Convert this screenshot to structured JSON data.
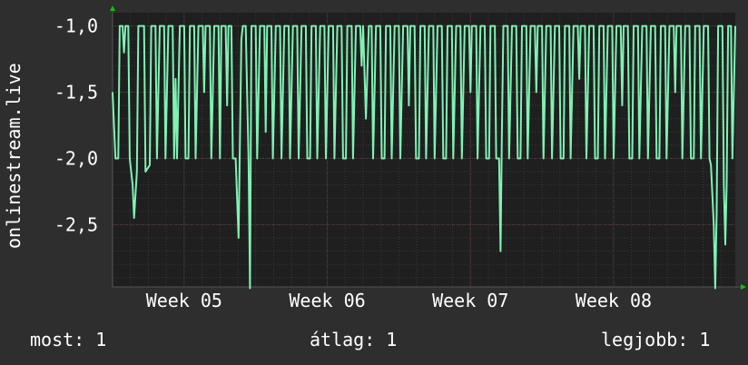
{
  "chart_data": {
    "type": "line",
    "ylabel": "onlinestream.live",
    "y_ticks": [
      "-1,0",
      "-1,5",
      "-2,0",
      "-2,5"
    ],
    "y_tick_values": [
      -1.0,
      -1.5,
      -2.0,
      -2.5
    ],
    "ylim": [
      -2.97,
      -0.9
    ],
    "x_ticks": [
      "Week 05",
      "Week 06",
      "Week 07",
      "Week 08"
    ],
    "xlim": [
      4.5,
      8.85
    ],
    "x_tick_values": [
      5,
      6,
      7,
      8
    ],
    "grid": true,
    "background": "#1f1f1f",
    "line_color": "#7ff2b4",
    "grid_color": "#3a3a3a",
    "axis_arrow_color": "#00cc00",
    "series": [
      {
        "name": "",
        "points": [
          [
            4.5,
            -1.5
          ],
          [
            4.52,
            -2.0
          ],
          [
            4.54,
            -2.0
          ],
          [
            4.55,
            -1.0
          ],
          [
            4.57,
            -1.0
          ],
          [
            4.58,
            -1.2
          ],
          [
            4.59,
            -1.0
          ],
          [
            4.61,
            -1.0
          ],
          [
            4.62,
            -2.0
          ],
          [
            4.64,
            -2.2
          ],
          [
            4.65,
            -2.45
          ],
          [
            4.67,
            -2.1
          ],
          [
            4.68,
            -1.0
          ],
          [
            4.72,
            -1.0
          ],
          [
            4.73,
            -2.1
          ],
          [
            4.76,
            -2.05
          ],
          [
            4.77,
            -1.0
          ],
          [
            4.8,
            -1.0
          ],
          [
            4.81,
            -2.0
          ],
          [
            4.83,
            -1.0
          ],
          [
            4.86,
            -1.0
          ],
          [
            4.87,
            -2.0
          ],
          [
            4.89,
            -1.0
          ],
          [
            4.92,
            -1.0
          ],
          [
            4.93,
            -2.0
          ],
          [
            4.94,
            -1.4
          ],
          [
            4.95,
            -2.0
          ],
          [
            4.97,
            -1.0
          ],
          [
            5.0,
            -1.0
          ],
          [
            5.01,
            -2.0
          ],
          [
            5.03,
            -2.0
          ],
          [
            5.04,
            -1.0
          ],
          [
            5.07,
            -1.0
          ],
          [
            5.08,
            -2.0
          ],
          [
            5.1,
            -1.0
          ],
          [
            5.13,
            -1.0
          ],
          [
            5.14,
            -1.5
          ],
          [
            5.15,
            -1.0
          ],
          [
            5.18,
            -1.0
          ],
          [
            5.19,
            -2.0
          ],
          [
            5.21,
            -1.0
          ],
          [
            5.24,
            -1.0
          ],
          [
            5.25,
            -2.0
          ],
          [
            5.26,
            -1.0
          ],
          [
            5.29,
            -1.0
          ],
          [
            5.3,
            -1.6
          ],
          [
            5.31,
            -1.0
          ],
          [
            5.33,
            -1.0
          ],
          [
            5.34,
            -2.0
          ],
          [
            5.36,
            -2.0
          ],
          [
            5.37,
            -2.3
          ],
          [
            5.38,
            -2.6
          ],
          [
            5.4,
            -1.1
          ],
          [
            5.41,
            -1.0
          ],
          [
            5.43,
            -1.0
          ],
          [
            5.44,
            -1.5
          ],
          [
            5.45,
            -2.0
          ],
          [
            5.46,
            -2.98
          ],
          [
            5.47,
            -1.0
          ],
          [
            5.5,
            -1.0
          ],
          [
            5.51,
            -2.0
          ],
          [
            5.53,
            -1.0
          ],
          [
            5.56,
            -1.0
          ],
          [
            5.57,
            -1.8
          ],
          [
            5.58,
            -1.0
          ],
          [
            5.61,
            -1.0
          ],
          [
            5.62,
            -2.0
          ],
          [
            5.64,
            -1.0
          ],
          [
            5.67,
            -1.0
          ],
          [
            5.68,
            -2.0
          ],
          [
            5.7,
            -1.0
          ],
          [
            5.73,
            -1.0
          ],
          [
            5.74,
            -2.0
          ],
          [
            5.75,
            -1.5
          ],
          [
            5.76,
            -1.0
          ],
          [
            5.79,
            -1.0
          ],
          [
            5.8,
            -2.0
          ],
          [
            5.82,
            -1.0
          ],
          [
            5.85,
            -1.0
          ],
          [
            5.86,
            -2.0
          ],
          [
            5.88,
            -2.0
          ],
          [
            5.89,
            -1.0
          ],
          [
            5.92,
            -1.0
          ],
          [
            5.93,
            -2.0
          ],
          [
            5.95,
            -1.0
          ],
          [
            5.98,
            -1.0
          ],
          [
            5.99,
            -2.0
          ],
          [
            6.01,
            -1.0
          ],
          [
            6.04,
            -1.0
          ],
          [
            6.05,
            -2.0
          ],
          [
            6.06,
            -1.5
          ],
          [
            6.07,
            -1.0
          ],
          [
            6.1,
            -1.0
          ],
          [
            6.11,
            -2.0
          ],
          [
            6.13,
            -2.0
          ],
          [
            6.14,
            -1.0
          ],
          [
            6.17,
            -1.0
          ],
          [
            6.18,
            -2.0
          ],
          [
            6.2,
            -1.0
          ],
          [
            6.23,
            -1.0
          ],
          [
            6.24,
            -1.3
          ],
          [
            6.25,
            -1.0
          ],
          [
            6.27,
            -1.7
          ],
          [
            6.29,
            -1.0
          ],
          [
            6.31,
            -1.0
          ],
          [
            6.32,
            -2.0
          ],
          [
            6.34,
            -1.0
          ],
          [
            6.37,
            -1.0
          ],
          [
            6.38,
            -2.0
          ],
          [
            6.4,
            -2.0
          ],
          [
            6.41,
            -1.0
          ],
          [
            6.44,
            -1.0
          ],
          [
            6.45,
            -2.0
          ],
          [
            6.47,
            -1.0
          ],
          [
            6.5,
            -1.0
          ],
          [
            6.51,
            -2.0
          ],
          [
            6.53,
            -1.0
          ],
          [
            6.56,
            -1.0
          ],
          [
            6.57,
            -1.6
          ],
          [
            6.58,
            -1.0
          ],
          [
            6.61,
            -1.0
          ],
          [
            6.62,
            -2.0
          ],
          [
            6.64,
            -2.0
          ],
          [
            6.65,
            -1.0
          ],
          [
            6.68,
            -1.0
          ],
          [
            6.69,
            -2.0
          ],
          [
            6.71,
            -1.0
          ],
          [
            6.74,
            -1.0
          ],
          [
            6.75,
            -2.0
          ],
          [
            6.77,
            -1.0
          ],
          [
            6.8,
            -1.0
          ],
          [
            6.81,
            -2.0
          ],
          [
            6.83,
            -2.0
          ],
          [
            6.84,
            -1.0
          ],
          [
            6.87,
            -1.0
          ],
          [
            6.88,
            -2.0
          ],
          [
            6.9,
            -1.0
          ],
          [
            6.93,
            -1.0
          ],
          [
            6.94,
            -2.0
          ],
          [
            6.96,
            -1.0
          ],
          [
            6.99,
            -1.0
          ],
          [
            7.0,
            -1.5
          ],
          [
            7.01,
            -1.0
          ],
          [
            7.04,
            -1.0
          ],
          [
            7.05,
            -2.0
          ],
          [
            7.07,
            -1.0
          ],
          [
            7.1,
            -1.0
          ],
          [
            7.11,
            -2.0
          ],
          [
            7.13,
            -2.0
          ],
          [
            7.14,
            -1.0
          ],
          [
            7.17,
            -1.0
          ],
          [
            7.18,
            -2.0
          ],
          [
            7.2,
            -2.0
          ],
          [
            7.21,
            -2.7
          ],
          [
            7.22,
            -1.8
          ],
          [
            7.23,
            -1.0
          ],
          [
            7.26,
            -1.0
          ],
          [
            7.27,
            -2.0
          ],
          [
            7.29,
            -1.0
          ],
          [
            7.32,
            -1.0
          ],
          [
            7.33,
            -2.0
          ],
          [
            7.35,
            -2.0
          ],
          [
            7.36,
            -1.0
          ],
          [
            7.39,
            -1.0
          ],
          [
            7.4,
            -2.0
          ],
          [
            7.42,
            -1.0
          ],
          [
            7.45,
            -1.0
          ],
          [
            7.46,
            -1.5
          ],
          [
            7.47,
            -1.0
          ],
          [
            7.5,
            -1.0
          ],
          [
            7.51,
            -2.0
          ],
          [
            7.53,
            -1.0
          ],
          [
            7.56,
            -1.0
          ],
          [
            7.57,
            -2.0
          ],
          [
            7.59,
            -1.0
          ],
          [
            7.62,
            -1.0
          ],
          [
            7.63,
            -2.0
          ],
          [
            7.65,
            -2.0
          ],
          [
            7.66,
            -1.0
          ],
          [
            7.69,
            -1.0
          ],
          [
            7.7,
            -2.0
          ],
          [
            7.72,
            -1.0
          ],
          [
            7.75,
            -1.0
          ],
          [
            7.76,
            -1.4
          ],
          [
            7.77,
            -1.0
          ],
          [
            7.8,
            -1.0
          ],
          [
            7.81,
            -2.0
          ],
          [
            7.83,
            -1.0
          ],
          [
            7.86,
            -1.0
          ],
          [
            7.87,
            -2.0
          ],
          [
            7.89,
            -2.0
          ],
          [
            7.9,
            -1.0
          ],
          [
            7.93,
            -1.0
          ],
          [
            7.94,
            -2.0
          ],
          [
            7.96,
            -1.0
          ],
          [
            7.99,
            -1.0
          ],
          [
            8.0,
            -2.0
          ],
          [
            8.02,
            -1.0
          ],
          [
            8.05,
            -1.0
          ],
          [
            8.06,
            -1.6
          ],
          [
            8.07,
            -1.0
          ],
          [
            8.1,
            -1.0
          ],
          [
            8.11,
            -2.0
          ],
          [
            8.13,
            -2.0
          ],
          [
            8.14,
            -1.0
          ],
          [
            8.17,
            -1.0
          ],
          [
            8.18,
            -2.0
          ],
          [
            8.2,
            -1.0
          ],
          [
            8.23,
            -1.0
          ],
          [
            8.24,
            -2.0
          ],
          [
            8.26,
            -1.0
          ],
          [
            8.29,
            -1.0
          ],
          [
            8.3,
            -2.0
          ],
          [
            8.32,
            -2.0
          ],
          [
            8.33,
            -1.0
          ],
          [
            8.36,
            -1.0
          ],
          [
            8.37,
            -2.0
          ],
          [
            8.39,
            -1.0
          ],
          [
            8.42,
            -1.0
          ],
          [
            8.43,
            -1.5
          ],
          [
            8.44,
            -1.0
          ],
          [
            8.47,
            -1.0
          ],
          [
            8.48,
            -2.0
          ],
          [
            8.5,
            -1.0
          ],
          [
            8.53,
            -1.0
          ],
          [
            8.54,
            -2.0
          ],
          [
            8.56,
            -2.0
          ],
          [
            8.57,
            -1.0
          ],
          [
            8.6,
            -1.0
          ],
          [
            8.61,
            -2.0
          ],
          [
            8.63,
            -1.0
          ],
          [
            8.66,
            -1.0
          ],
          [
            8.67,
            -2.0
          ],
          [
            8.68,
            -2.05
          ],
          [
            8.7,
            -2.5
          ],
          [
            8.71,
            -2.98
          ],
          [
            8.72,
            -2.4
          ],
          [
            8.73,
            -1.0
          ],
          [
            8.76,
            -1.0
          ],
          [
            8.77,
            -2.2
          ],
          [
            8.78,
            -2.65
          ],
          [
            8.79,
            -2.2
          ],
          [
            8.8,
            -1.0
          ],
          [
            8.82,
            -1.0
          ],
          [
            8.83,
            -2.0
          ],
          [
            8.85,
            -1.0
          ]
        ]
      }
    ]
  },
  "legend": {
    "now": "most: 1",
    "average": "átlag: 1",
    "max": "legjobb: 1"
  }
}
